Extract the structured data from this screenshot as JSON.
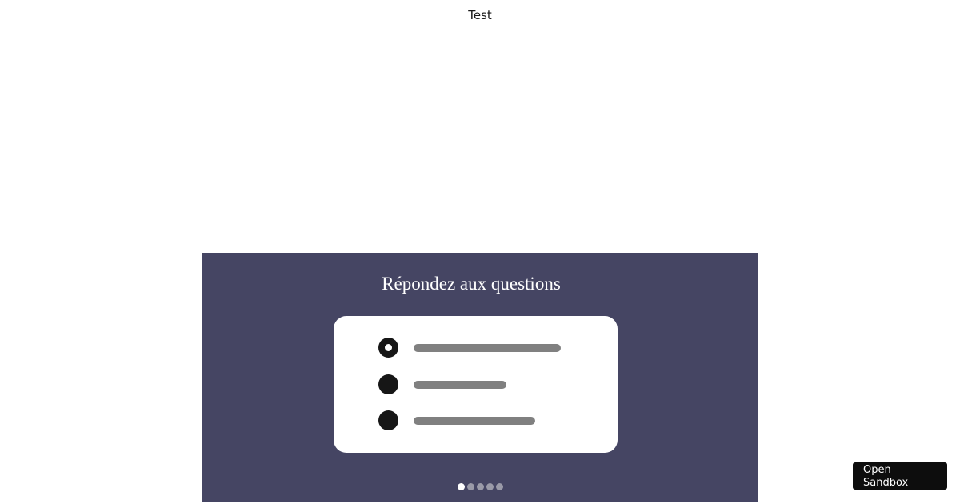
{
  "page": {
    "title": "Test"
  },
  "slide": {
    "heading": "Répondez aux questions",
    "background_color": "#454563",
    "card": {
      "options": [
        {
          "selected": true
        },
        {
          "selected": false
        },
        {
          "selected": false
        }
      ]
    },
    "pager": {
      "total": 5,
      "current": 1
    }
  },
  "sandbox_button": {
    "line1": "Open",
    "line2": "Sandbox"
  }
}
